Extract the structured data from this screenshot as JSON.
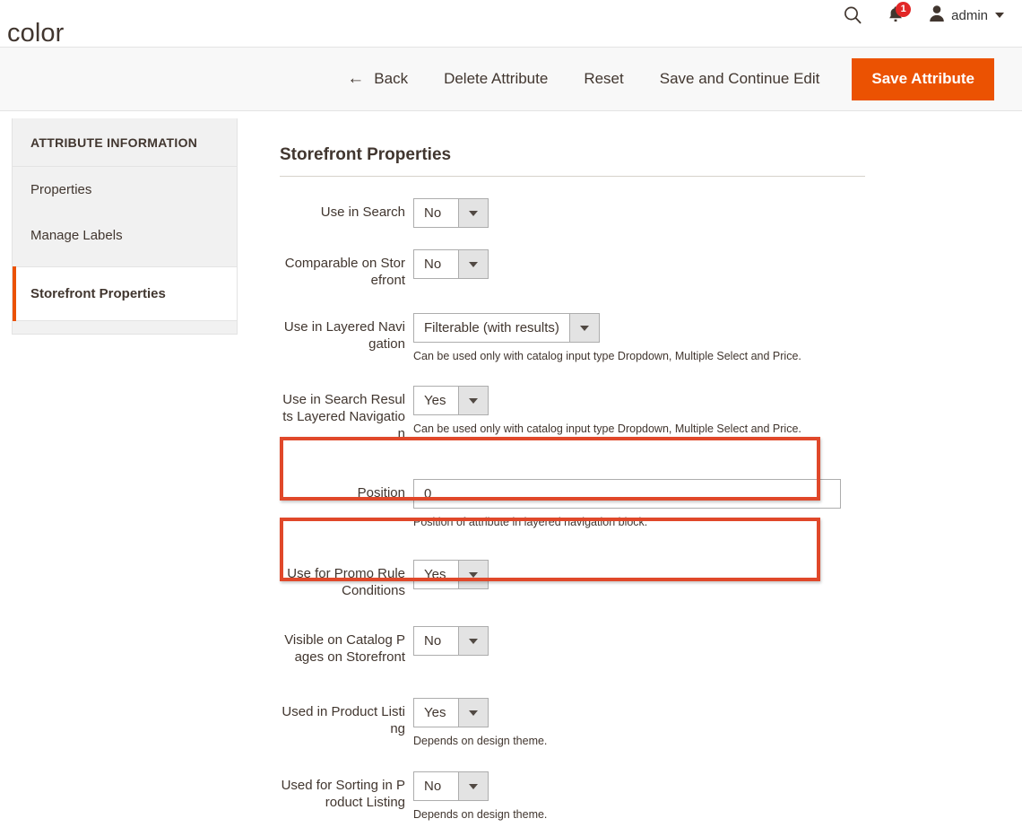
{
  "header": {
    "page_title": "color",
    "search_icon": "search-icon",
    "notifications_icon": "bell-icon",
    "notifications_count": "1",
    "user_icon": "user-avatar-icon",
    "user_name": "admin",
    "user_caret_icon": "chevron-down-icon"
  },
  "toolbar": {
    "back_icon": "arrow-left-icon",
    "back_label": "Back",
    "delete_label": "Delete Attribute",
    "reset_label": "Reset",
    "save_continue_label": "Save and Continue Edit",
    "save_label": "Save Attribute",
    "primary_color": "#eb5202"
  },
  "sidebar": {
    "title": "ATTRIBUTE INFORMATION",
    "active_marker_color": "#eb5202",
    "items": [
      {
        "label": "Properties",
        "active": false
      },
      {
        "label": "Manage Labels",
        "active": false
      },
      {
        "label": "Storefront Properties",
        "active": true
      }
    ]
  },
  "main": {
    "fieldset_title": "Storefront Properties",
    "fields": [
      {
        "label": "Use in Search",
        "type": "select",
        "value": "No",
        "note": "",
        "highlighted": false
      },
      {
        "label": "Comparable on Storefront",
        "type": "select",
        "value": "No",
        "note": "",
        "highlighted": false
      },
      {
        "label": "Use in Layered Navigation",
        "type": "select",
        "value": "Filterable (with results)",
        "note": "Can be used only with catalog input type Dropdown, Multiple Select and Price.",
        "highlighted": true
      },
      {
        "label": "Use in Search Results Layered Navigation",
        "type": "select",
        "value": "Yes",
        "note": "Can be used only with catalog input type Dropdown, Multiple Select and Price.",
        "highlighted": true
      },
      {
        "label": "Position",
        "type": "text",
        "value": "0",
        "note": "Position of attribute in layered navigation block.",
        "highlighted": false
      },
      {
        "label": "Use for Promo Rule Conditions",
        "type": "select",
        "value": "Yes",
        "note": "",
        "highlighted": false
      },
      {
        "label": "Visible on Catalog Pages on Storefront",
        "type": "select",
        "value": "No",
        "note": "",
        "highlighted": false
      },
      {
        "label": "Used in Product Listing",
        "type": "select",
        "value": "Yes",
        "note": "Depends on design theme.",
        "highlighted": false
      },
      {
        "label": "Used for Sorting in Product Listing",
        "type": "select",
        "value": "No",
        "note": "Depends on design theme.",
        "highlighted": false
      }
    ],
    "highlight_color": "#e0482a"
  }
}
